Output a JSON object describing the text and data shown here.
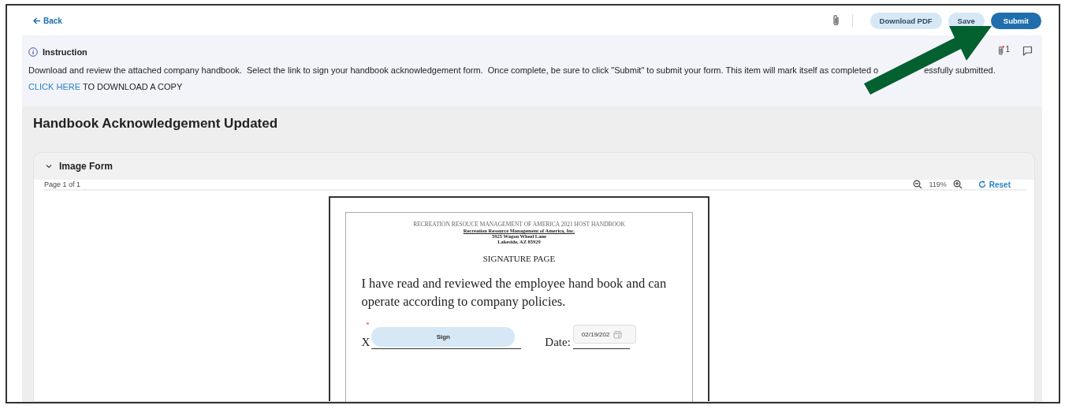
{
  "toolbar": {
    "back": "Back",
    "buttons": [
      {
        "label": "Download PDF",
        "kind": "secondary"
      },
      {
        "label": "Save",
        "kind": "secondary"
      },
      {
        "label": "Submit",
        "kind": "primary"
      }
    ]
  },
  "instruction": {
    "title": "Instruction",
    "text_before": "Download and review the attached company handbook.  Select the link to sign your handbook acknowledgement form.  Once complete, be sure to click \"Submit\" to submit your form. This item will mark itself as completed o",
    "text_after": "essfully submitted.",
    "link": "CLICK HERE",
    "link_suffix": "TO DOWNLOAD A COPY",
    "attachment_count": "1"
  },
  "form": {
    "title": "Handbook Acknowledgement Updated",
    "section": {
      "title": "Image Form",
      "expanded": true
    },
    "viewer": {
      "page": "Page 1 of 1",
      "zoom": "119%",
      "reset": "Reset"
    },
    "document": {
      "header": "RECREATION RESOUCE MANAGEMENT OF AMERICA 2021 HOST HANDBOOK",
      "company": "Recreation Resource Management of America, Inc.",
      "address_lines": [
        "5925 Wagon Wheel Lane",
        "Lakeside, AZ 85929"
      ],
      "heading": "SIGNATURE PAGE",
      "statement": "I have read and reviewed the employee hand book and can operate according to company policies.",
      "sign_prefix": "X",
      "sign_button": "Sign",
      "required_mark": "*",
      "date_label": "Date:",
      "date_value": "02/19/202"
    }
  }
}
